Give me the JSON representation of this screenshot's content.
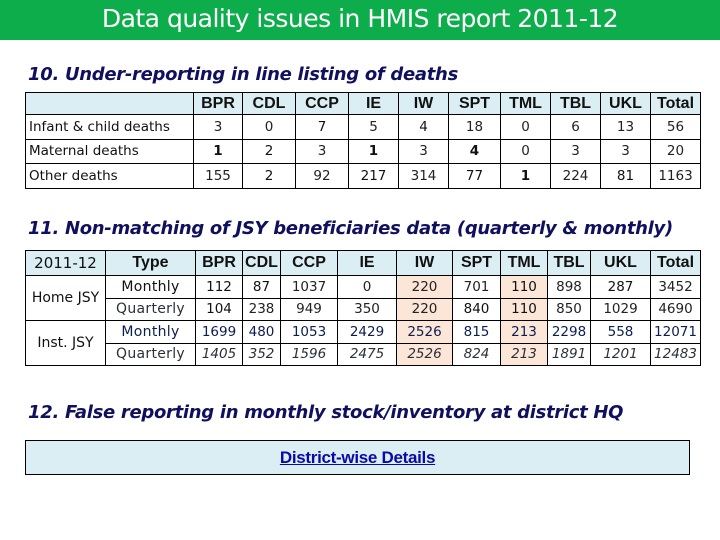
{
  "header": {
    "title": "Data quality issues in HMIS report 2011-12",
    "color": "#0ead4c"
  },
  "section10": {
    "title": "10.  Under-reporting in line listing of deaths",
    "columns": [
      "",
      "BPR",
      "CDL",
      "CCP",
      "IE",
      "IW",
      "SPT",
      "TML",
      "TBL",
      "UKL",
      "Total"
    ],
    "rows": [
      {
        "label": "Infant & child deaths",
        "values": [
          "3",
          "0",
          "7",
          "5",
          "4",
          "18",
          "0",
          "6",
          "13",
          "56"
        ]
      },
      {
        "label": "Maternal deaths",
        "values": [
          "1",
          "2",
          "3",
          "1",
          "3",
          "4",
          "0",
          "3",
          "3",
          "20"
        ]
      },
      {
        "label": "Other deaths",
        "values": [
          "155",
          "2",
          "92",
          "217",
          "314",
          "77",
          "1",
          "224",
          "81",
          "1163"
        ]
      }
    ]
  },
  "section11": {
    "title": "11.  Non-matching of  JSY beneficiaries data (quarterly & monthly)",
    "columns": [
      "2011-12",
      "Type",
      "BPR",
      "CDL",
      "CCP",
      "IE",
      "IW",
      "SPT",
      "TML",
      "TBL",
      "UKL",
      "Total"
    ],
    "groups": [
      {
        "label": "Home JSY",
        "rows": [
          {
            "type": "Monthly",
            "values": [
              "112",
              "87",
              "1037",
              "0",
              "220",
              "701",
              "110",
              "898",
              "287",
              "3452"
            ]
          },
          {
            "type": "Quarterly",
            "values": [
              "104",
              "238",
              "949",
              "350",
              "220",
              "840",
              "110",
              "850",
              "1029",
              "4690"
            ]
          }
        ]
      },
      {
        "label": "Inst. JSY",
        "rows": [
          {
            "type": "Monthly",
            "values": [
              "1699",
              "480",
              "1053",
              "2429",
              "2526",
              "815",
              "213",
              "2298",
              "558",
              "12071"
            ]
          },
          {
            "type": "Quarterly",
            "values": [
              "1405",
              "352",
              "1596",
              "2475",
              "2526",
              "824",
              "213",
              "1891",
              "1201",
              "12483"
            ]
          }
        ]
      }
    ],
    "highlighted_columns": [
      "IW",
      "TML"
    ],
    "highlight_color": "#fce6d8"
  },
  "section12": {
    "title": "12.  False reporting in monthly stock/inventory at district HQ",
    "link_label": "District-wise Details"
  }
}
